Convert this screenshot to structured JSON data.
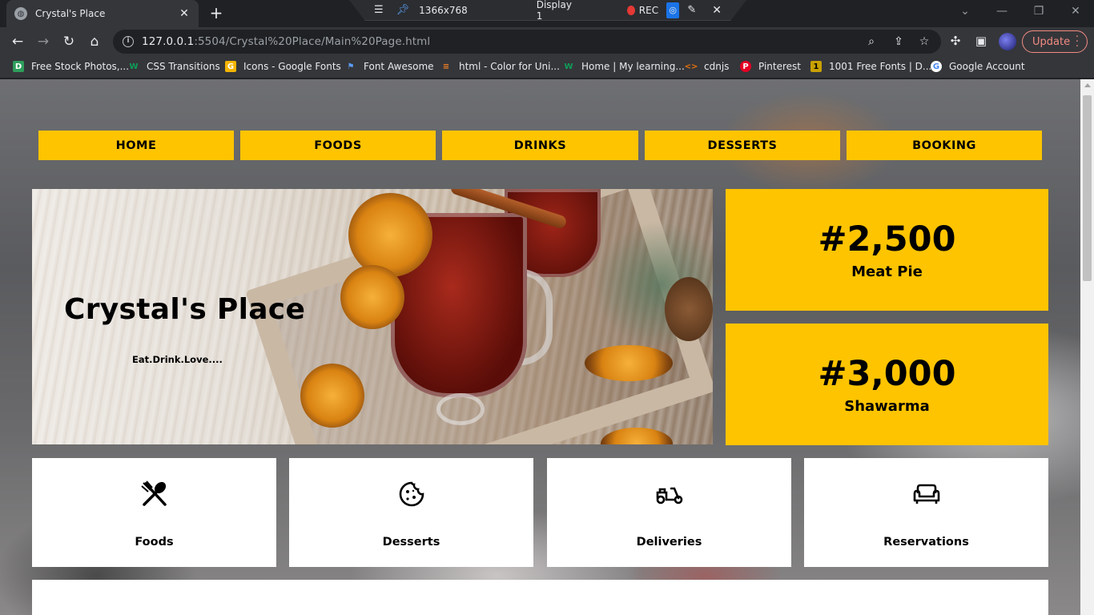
{
  "browser": {
    "tab_title": "Crystal's Place",
    "new_tab": "+",
    "tab_close": "✕",
    "recorder": {
      "resolution": "1366x768",
      "display": "Display 1",
      "rec_label": "REC"
    },
    "url_host": "127.0.0.1",
    "url_rest": ":5504/Crystal%20Place/Main%20Page.html",
    "update_label": "Update",
    "bookmarks": [
      {
        "label": "Free Stock Photos,...",
        "icon": "D",
        "color": "#2e9e5b"
      },
      {
        "label": "CSS Transitions",
        "icon": "W",
        "color": "#0f9d58"
      },
      {
        "label": "Icons - Google Fonts",
        "icon": "G",
        "color": "#f4b400"
      },
      {
        "label": "Font Awesome",
        "icon": "⚑",
        "color": "#5b9cf6"
      },
      {
        "label": "html - Color for Uni...",
        "icon": "≡",
        "color": "#f48024"
      },
      {
        "label": "Home | My learning...",
        "icon": "W",
        "color": "#0f9d58"
      },
      {
        "label": "cdnjs",
        "icon": "<>",
        "color": "#e8710a"
      },
      {
        "label": "Pinterest",
        "icon": "P",
        "color": "#e60023"
      },
      {
        "label": "1001 Free Fonts | D...",
        "icon": "1",
        "color": "#c8a100"
      },
      {
        "label": "Google Account",
        "icon": "G",
        "color": "#4285f4"
      }
    ]
  },
  "site": {
    "nav": [
      "HOME",
      "FOODS",
      "DRINKS",
      "DESSERTS",
      "BOOKING"
    ],
    "hero": {
      "title": "Crystal's Place",
      "tagline": "Eat.Drink.Love...."
    },
    "prices": [
      {
        "price": "#2,500",
        "item": "Meat Pie"
      },
      {
        "price": "#3,000",
        "item": "Shawarma"
      }
    ],
    "features": [
      {
        "label": "Foods",
        "icon": "utensils-icon"
      },
      {
        "label": "Desserts",
        "icon": "cookie-icon"
      },
      {
        "label": "Deliveries",
        "icon": "scooter-icon"
      },
      {
        "label": "Reservations",
        "icon": "couch-icon"
      }
    ],
    "accent_color": "#ffc400"
  }
}
